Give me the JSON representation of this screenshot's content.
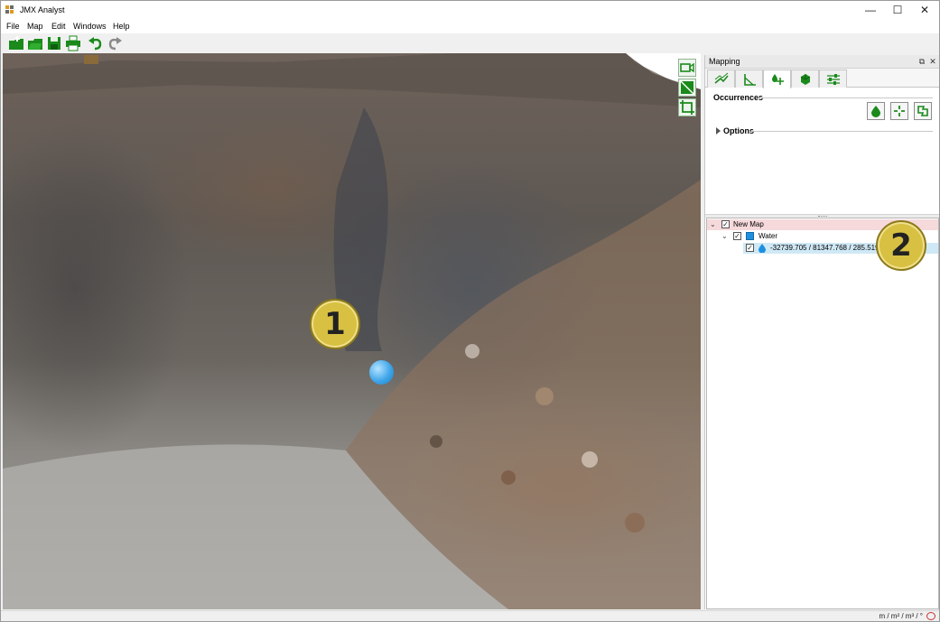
{
  "window": {
    "title": "JMX Analyst",
    "controls": {
      "minimize": "—",
      "maximize": "☐",
      "close": "✕"
    }
  },
  "menu": {
    "items": [
      "File",
      "Map",
      "Edit",
      "Windows",
      "Help"
    ]
  },
  "toolbar": {
    "buttons": [
      "new-project-icon",
      "open-project-icon",
      "save-icon",
      "print-icon",
      "undo-icon",
      "redo-icon"
    ]
  },
  "viewport": {
    "tools": [
      "video-camera-icon",
      "perspective-icon",
      "crop-icon"
    ],
    "callout_1": "1",
    "marker_color": "#3fa6ea"
  },
  "mapping_panel": {
    "title": "Mapping",
    "header_controls": {
      "float": "⧉",
      "close": "✕"
    },
    "tabs": [
      "planes-icon",
      "angle-icon",
      "occurrences-icon",
      "blocks-icon",
      "settings-sliders-icon"
    ],
    "active_tab": 2,
    "occurrences": {
      "label": "Occurrences",
      "buttons": [
        "water-drop-icon",
        "crosshair-icon",
        "map-outline-icon"
      ]
    },
    "options_label": "Options"
  },
  "tree": {
    "root": {
      "label": "New Map",
      "checked": "✓",
      "expanded": "⌄"
    },
    "group": {
      "label": "Water",
      "checked": "✓",
      "expanded": "⌄",
      "color": "#1e90e0"
    },
    "leaf": {
      "label": "-32739.705 / 81347.768 / 285.519",
      "checked": "✓"
    },
    "callout_2": "2"
  },
  "status": {
    "units": "m / m² / m³ / °"
  },
  "colors": {
    "accent_green": "#1b8a1b",
    "callout_yellow": "#d8c043",
    "selection_root": "#f6d9db",
    "selection_leaf": "#cfe8f5"
  }
}
